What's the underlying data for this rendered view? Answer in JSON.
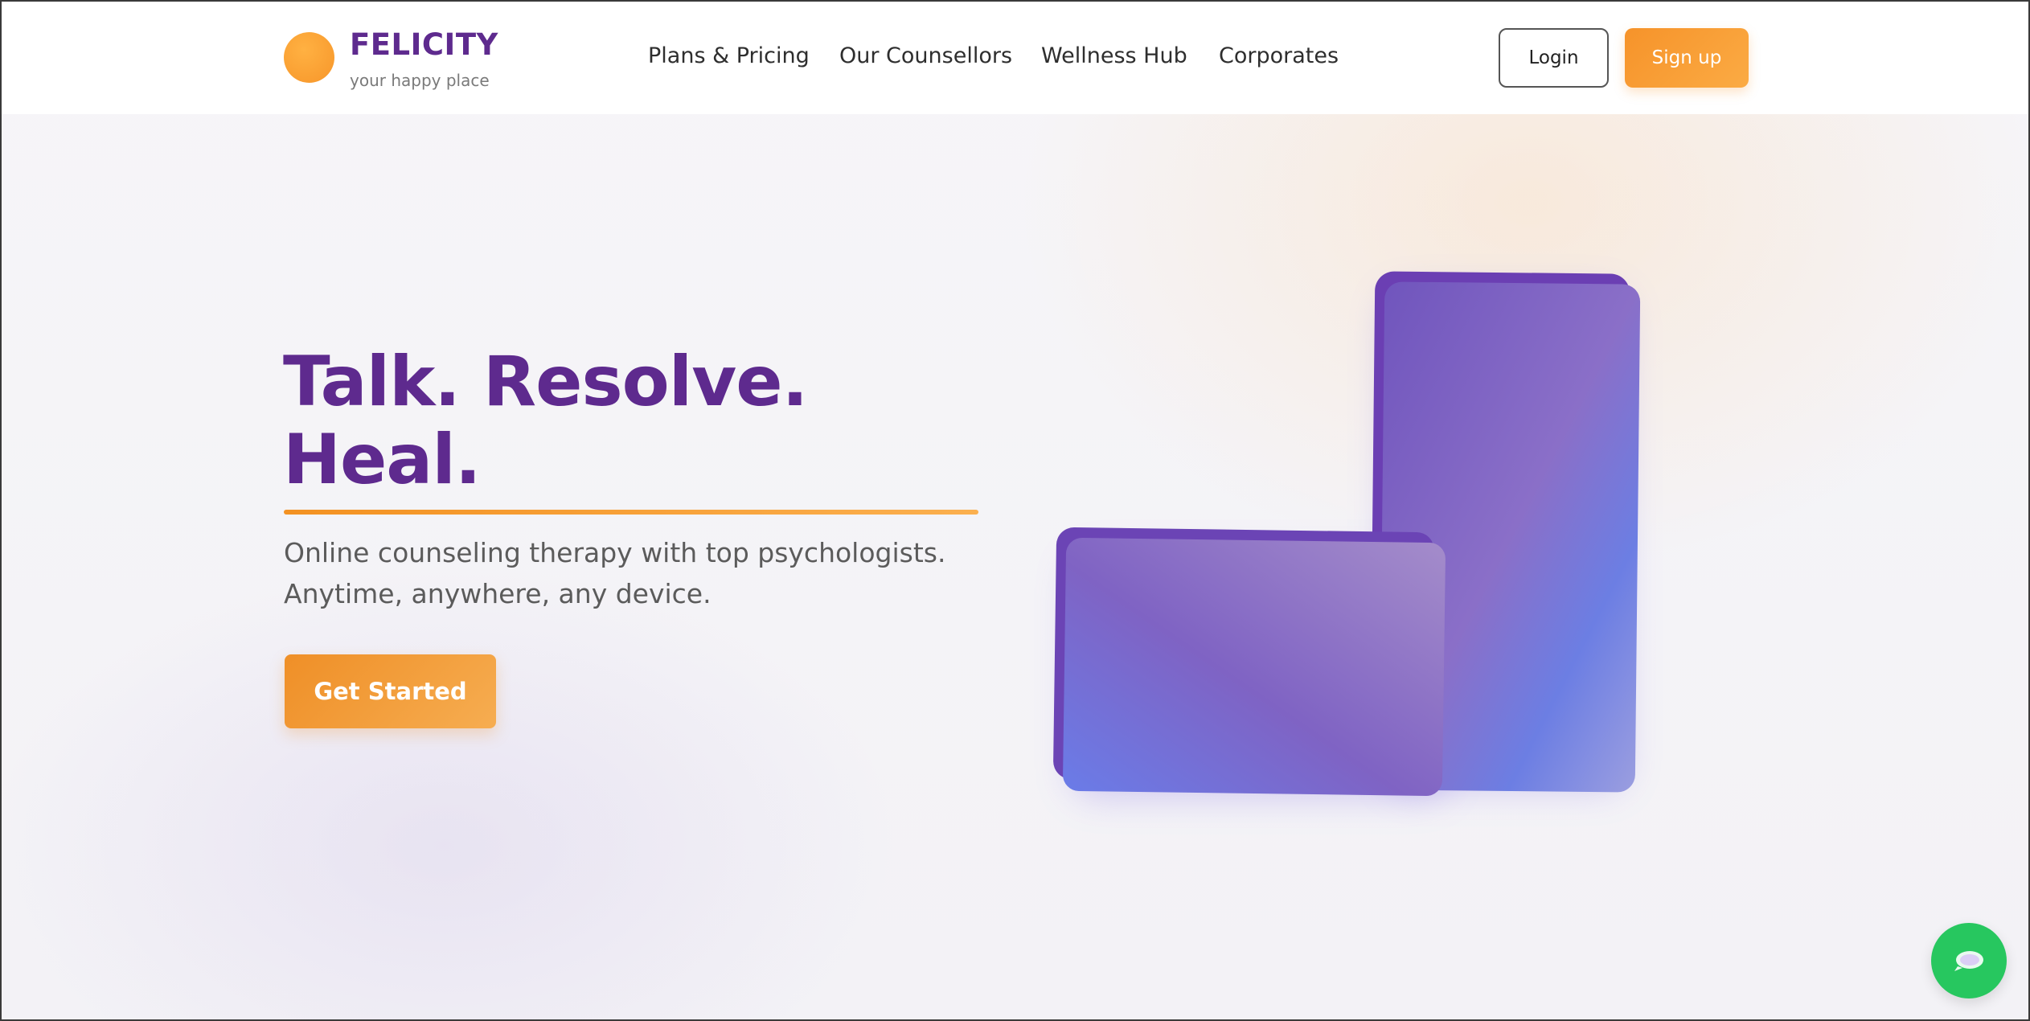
{
  "brand": {
    "name": "FELICITY",
    "tagline": "your happy place"
  },
  "nav": {
    "items": [
      {
        "label": "Plans & Pricing"
      },
      {
        "label": "Our Counsellors"
      },
      {
        "label": "Wellness Hub"
      },
      {
        "label": "Corporates"
      }
    ]
  },
  "auth": {
    "login_label": "Login",
    "signup_label": "Sign up"
  },
  "hero": {
    "headline_line1": "Talk. Resolve.",
    "headline_line2": "Heal.",
    "subtext_line1": "Online counseling therapy with top psychologists.",
    "subtext_line2": "Anytime, anywhere, any device.",
    "cta_label": "Get Started"
  },
  "chat": {
    "icon": "chat-bubble-icon"
  },
  "colors": {
    "brand_purple": "#5e2a8e",
    "brand_orange": "#f7962a",
    "chat_green": "#27c75f",
    "card_violet": "#7258c2"
  }
}
